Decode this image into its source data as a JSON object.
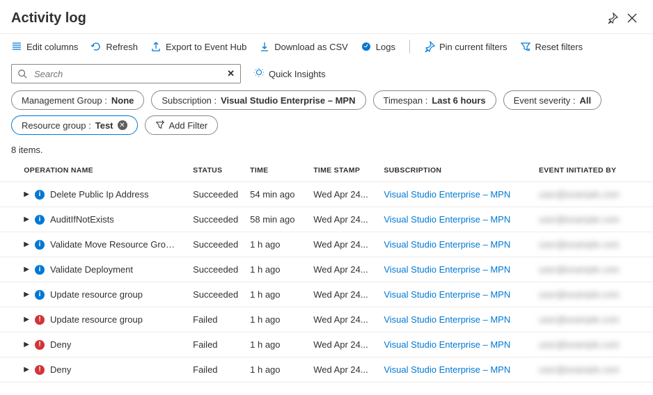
{
  "header": {
    "title": "Activity log"
  },
  "toolbar": {
    "edit_columns": "Edit columns",
    "refresh": "Refresh",
    "export": "Export to Event Hub",
    "download": "Download as CSV",
    "logs": "Logs",
    "pin": "Pin current filters",
    "reset": "Reset filters"
  },
  "search": {
    "placeholder": "Search",
    "quick_insights": "Quick Insights"
  },
  "filters": {
    "mgmt_label": "Management Group : ",
    "mgmt_value": "None",
    "sub_label": "Subscription : ",
    "sub_value": "Visual Studio Enterprise – MPN",
    "timespan_label": "Timespan : ",
    "timespan_value": "Last 6 hours",
    "severity_label": "Event severity : ",
    "severity_value": "All",
    "rg_label": "Resource group : ",
    "rg_value": "Test",
    "add_filter": "Add Filter"
  },
  "count_label": "8 items.",
  "columns": {
    "op": "OPERATION NAME",
    "status": "STATUS",
    "time": "TIME",
    "ts": "TIME STAMP",
    "sub": "SUBSCRIPTION",
    "by": "EVENT INITIATED BY"
  },
  "rows": [
    {
      "icon": "info",
      "op": "Delete Public Ip Address",
      "status": "Succeeded",
      "time": "54 min ago",
      "ts": "Wed Apr 24...",
      "sub": "Visual Studio Enterprise – MPN",
      "by": "user@example.com"
    },
    {
      "icon": "info",
      "op": "AuditIfNotExists",
      "status": "Succeeded",
      "time": "58 min ago",
      "ts": "Wed Apr 24...",
      "sub": "Visual Studio Enterprise – MPN",
      "by": "user@example.com"
    },
    {
      "icon": "info",
      "op": "Validate Move Resource Group Resources",
      "status": "Succeeded",
      "time": "1 h ago",
      "ts": "Wed Apr 24...",
      "sub": "Visual Studio Enterprise – MPN",
      "by": "user@example.com"
    },
    {
      "icon": "info",
      "op": "Validate Deployment",
      "status": "Succeeded",
      "time": "1 h ago",
      "ts": "Wed Apr 24...",
      "sub": "Visual Studio Enterprise – MPN",
      "by": "user@example.com"
    },
    {
      "icon": "info",
      "op": "Update resource group",
      "status": "Succeeded",
      "time": "1 h ago",
      "ts": "Wed Apr 24...",
      "sub": "Visual Studio Enterprise – MPN",
      "by": "user@example.com"
    },
    {
      "icon": "error",
      "op": "Update resource group",
      "status": "Failed",
      "time": "1 h ago",
      "ts": "Wed Apr 24...",
      "sub": "Visual Studio Enterprise – MPN",
      "by": "user@example.com"
    },
    {
      "icon": "error",
      "op": "Deny",
      "status": "Failed",
      "time": "1 h ago",
      "ts": "Wed Apr 24...",
      "sub": "Visual Studio Enterprise – MPN",
      "by": "user@example.com"
    },
    {
      "icon": "error",
      "op": "Deny",
      "status": "Failed",
      "time": "1 h ago",
      "ts": "Wed Apr 24...",
      "sub": "Visual Studio Enterprise – MPN",
      "by": "user@example.com"
    }
  ]
}
